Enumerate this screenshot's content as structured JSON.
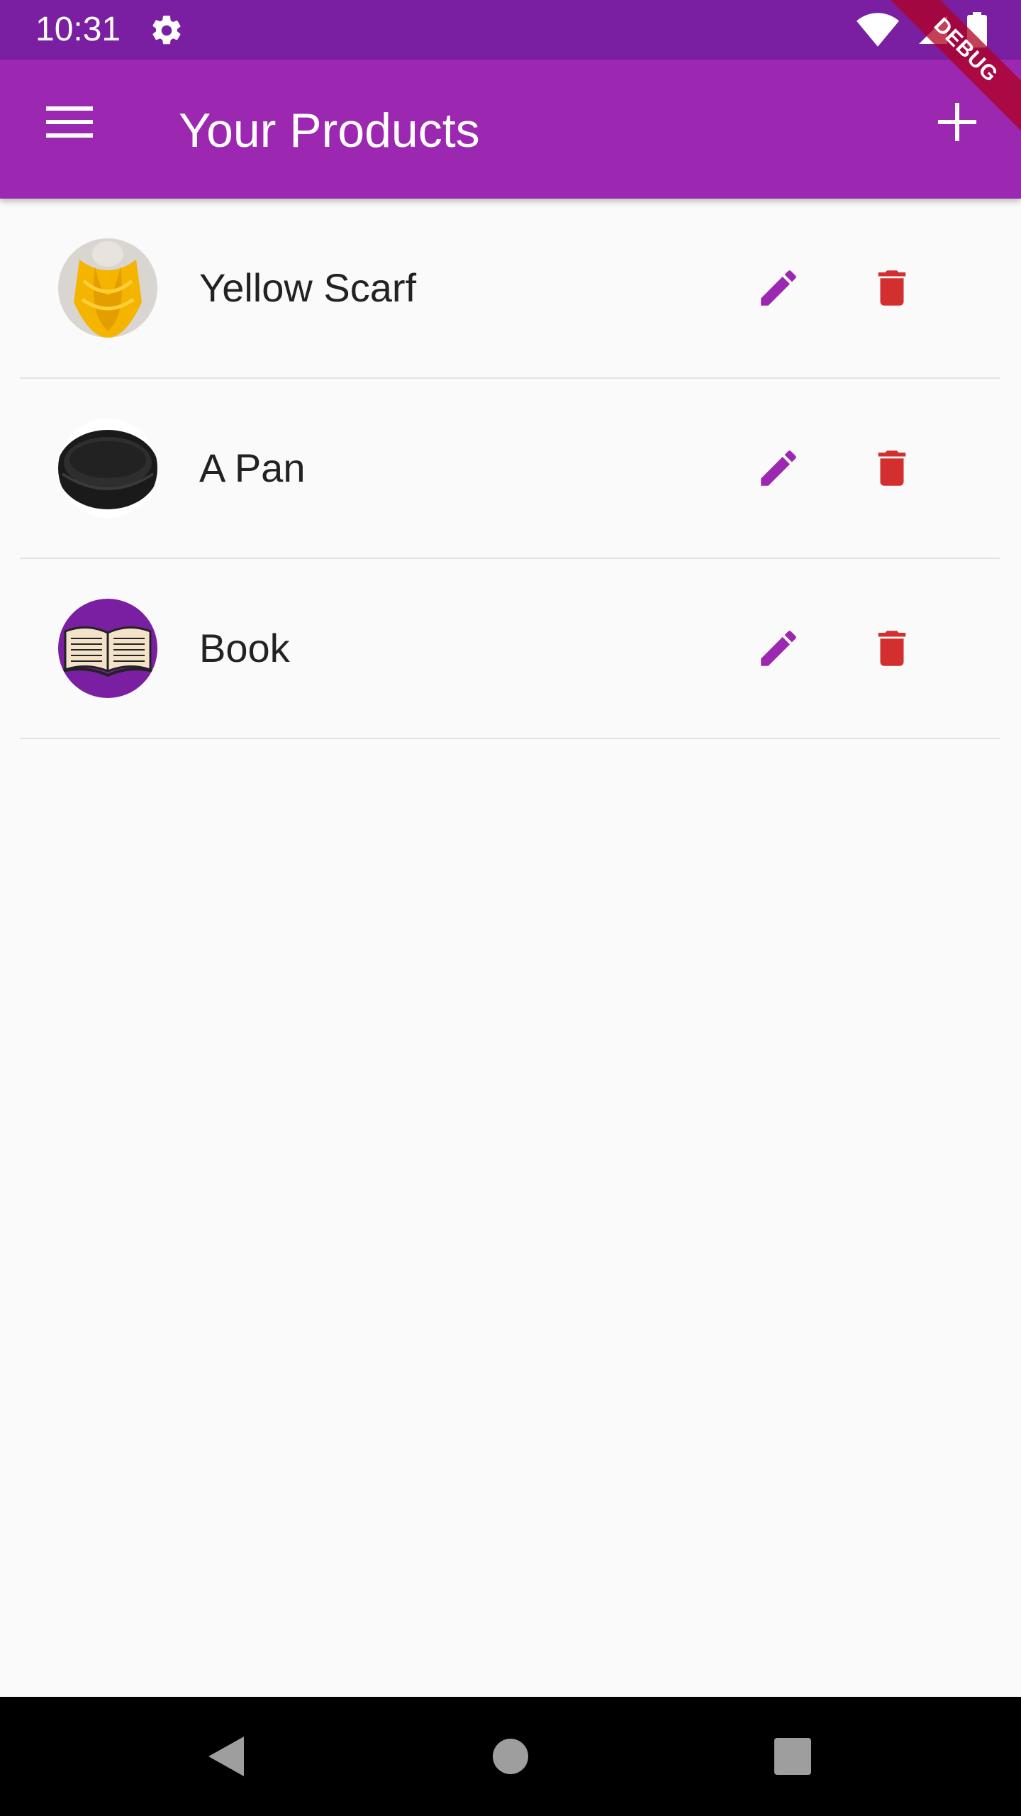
{
  "status_bar": {
    "time": "10:31"
  },
  "app_bar": {
    "title": "Your Products"
  },
  "debug_banner": {
    "label": "DEBUG"
  },
  "products": [
    {
      "title": "Yellow Scarf",
      "image": "yellow-scarf-image"
    },
    {
      "title": "A Pan",
      "image": "pan-image"
    },
    {
      "title": "Book",
      "image": "book-image"
    }
  ],
  "icons": {
    "menu": "menu-icon",
    "add": "plus-icon",
    "edit": "pencil-icon",
    "delete": "trash-icon"
  },
  "colors": {
    "status_bar": "#7b1fa2",
    "app_bar": "#9c27b0",
    "edit_icon": "#9c27b0",
    "delete_icon": "#d32f2f",
    "background": "#fafafa"
  }
}
